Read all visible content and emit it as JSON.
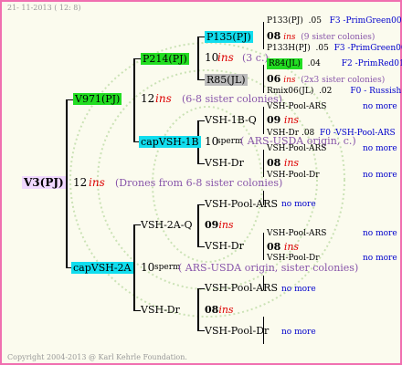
{
  "header": {
    "date": "21- 11-2013 ( 12:  8)"
  },
  "footer": {
    "copyright": "Copyright 2004-2013 @ Karl Kehrle Foundation."
  },
  "root": {
    "name": "V3(PJ)",
    "num": "12",
    "ins": "ins",
    "note": "(Drones from 6-8 sister colonies)"
  },
  "branchA": {
    "name": "V971(PJ)",
    "num": "12",
    "ins": "ins",
    "note": "(6-8 sister colonies)",
    "p214": {
      "name": "P214(PJ)",
      "num": "10",
      "ins": "ins",
      "note": "(3 c.)"
    },
    "p135": {
      "name": "P135(PJ)"
    },
    "r85": {
      "name": "R85(JL)"
    },
    "capvsh1b": {
      "name": "capVSH-1B",
      "num": "10",
      "sperm": "sperm",
      "note": "( ARS-USDA origin, c.)"
    },
    "vsh1bq": {
      "name": "VSH-1B-Q",
      "num": "09",
      "ins": "ins"
    },
    "vshdr1": {
      "name": "VSH-Dr"
    },
    "leaves": {
      "p133pj": {
        "name": "P133(PJ)",
        "val": ".05",
        "src": "F3 -PrimGreen00"
      },
      "ins08a": {
        "num": "08",
        "ins": "ins",
        "note": "(9 sister colonies)"
      },
      "p133hpj": {
        "name": "P133H(PJ)",
        "val": ".05",
        "src": "F3 -PrimGreen00"
      },
      "r84jl": {
        "name": "R84(JL)",
        "val": ".04",
        "src": "F2 -PrimRed01"
      },
      "ins06": {
        "num": "06",
        "ins": "ins",
        "note": "(2x3 sister colonies)"
      },
      "rmix06": {
        "name": "Rmix06(JL)",
        "val": ".02",
        "src": "F0 - Russish"
      },
      "vshpoolars1": {
        "name": "VSH-Pool-ARS",
        "note": "no more"
      },
      "vshdr08": {
        "name": "VSH-Dr",
        "val": ".08",
        "src": "F0 -VSH-Pool-ARS"
      },
      "vshpoolars2": {
        "name": "VSH-Pool-ARS",
        "note": "no more"
      },
      "ins08b": {
        "num": "08",
        "ins": "ins"
      },
      "vshpooldr1": {
        "name": "VSH-Pool-Dr",
        "note": "no more"
      }
    }
  },
  "branchB": {
    "name": "capVSH-2A",
    "num": "10",
    "sperm": "sperm",
    "note": "( ARS-USDA origin, sister colonies)",
    "vsh2aq": {
      "name": "VSH-2A-Q",
      "num": "09",
      "ins": "ins"
    },
    "vshdr2": {
      "name": "VSH-Dr",
      "num": "08",
      "ins": "ins"
    },
    "vshpoolars3": {
      "name": "VSH-Pool-ARS",
      "note": "no more"
    },
    "vshdr3": {
      "name": "VSH-Dr"
    },
    "vshpoolars4": {
      "name": "VSH-Pool-ARS",
      "note": "no more"
    },
    "ins08c": {
      "num": "08",
      "ins": "ins"
    },
    "vshpooldr2": {
      "name": "VSH-Pool-Dr",
      "note": "no more"
    },
    "vshpoolars5": {
      "name": "VSH-Pool-ARS",
      "note": "no more"
    },
    "vshpooldr3": {
      "name": "VSH-Pool-Dr",
      "note": "no more"
    }
  }
}
